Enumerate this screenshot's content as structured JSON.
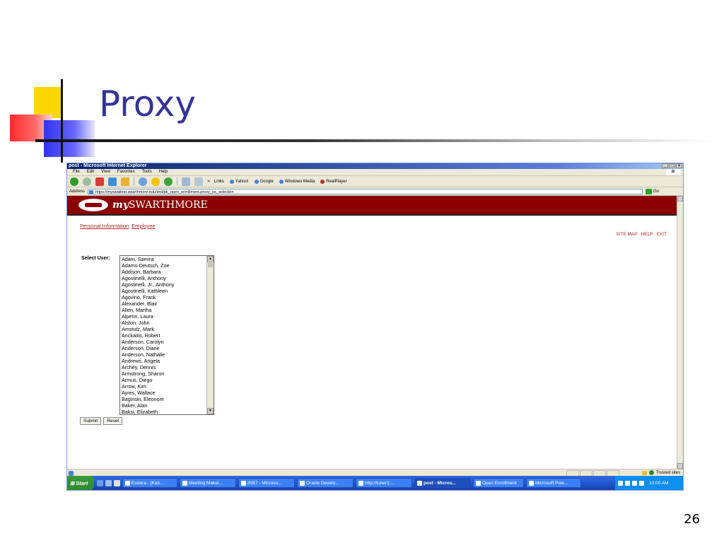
{
  "slide": {
    "title": "Proxy",
    "page_number": "26"
  },
  "browser": {
    "window_title": "post - Microsoft Internet Explorer",
    "menu": [
      "File",
      "Edit",
      "View",
      "Favorites",
      "Tools",
      "Help"
    ],
    "links_label": "Links",
    "links": [
      "Yahoo!",
      "Google",
      "Windows Media",
      "RealPlayer"
    ],
    "address_label": "Address",
    "address_url": "https://myswattest.swarthmore.edu/test/pk_open_enrollment.proxy_oe_selection",
    "go_label": "Go",
    "status_zone": "Trusted sites"
  },
  "page": {
    "brand_prefix": "my",
    "brand_name": "SWARTHMORE",
    "nav": [
      "Personal Information",
      "Employee"
    ],
    "util_links": [
      "SITE MAP",
      "HELP",
      "EXIT"
    ],
    "select_label": "Select User:",
    "users": [
      "Adam, Samira",
      "Adams-Deutsch, Zoe",
      "Addison, Barbara",
      "Agostinelli, Anthony",
      "Agostinelli, Jr., Anthony",
      "Agostinelli, Kathleen",
      "Agovino, Frank",
      "Alexander, Blair",
      "Allen, Martha",
      "Alperin, Laura",
      "Alston, John",
      "Amstutz, Mark",
      "Anckaitis, Robert",
      "Anderson, Carolyn",
      "Anderson, Diane",
      "Anderson, Nathalie",
      "Andrews, Angela",
      "Archey, Dennis",
      "Armstrong, Sharon",
      "Armus, Diego",
      "Arrow, Kim",
      "Ayres, Wallace",
      "Baginski, Eleonore",
      "Baker, Alan",
      "Baksi, Elizabeth"
    ],
    "submit_label": "Submit",
    "reset_label": "Reset"
  },
  "taskbar": {
    "start_label": "Start",
    "tasks": [
      "Eudora - [Kati...",
      "Meeting Maker...",
      "INB7 - Microso...",
      "Oracle Develo...",
      "http://tuner1....",
      "post - Micros...",
      "Open Enrollment",
      "Microsoft Pow..."
    ],
    "active_task_index": 5,
    "clock": "10:00 AM"
  }
}
